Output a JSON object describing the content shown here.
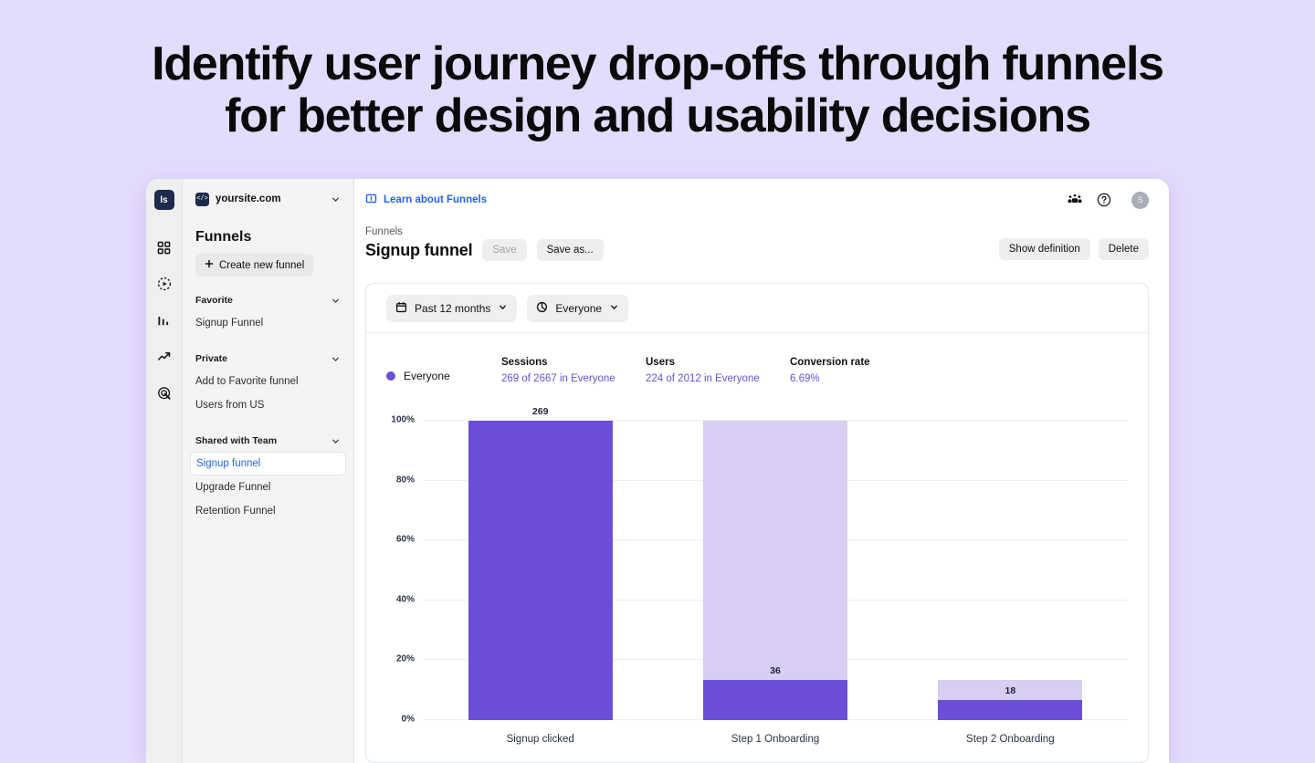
{
  "hero": {
    "headline": "Identify user journey drop-offs through funnels for better design and usability decisions"
  },
  "rail": {
    "logo_text": "ls",
    "items": [
      {
        "icon": "grid-dashboard-icon"
      },
      {
        "icon": "session-replay-icon"
      },
      {
        "icon": "bar-chart-icon"
      },
      {
        "icon": "trend-up-icon"
      },
      {
        "icon": "funnel-target-icon"
      }
    ]
  },
  "sidebar": {
    "site_badge": "</>",
    "site_name": "yoursite.com",
    "heading": "Funnels",
    "create_button": "Create new funnel",
    "groups": [
      {
        "label": "Favorite",
        "items": [
          {
            "label": "Signup Funnel",
            "active": false
          }
        ]
      },
      {
        "label": "Private",
        "items": [
          {
            "label": "Add to Favorite funnel",
            "active": false
          },
          {
            "label": "Users from US",
            "active": false
          }
        ]
      },
      {
        "label": "Shared with Team",
        "items": [
          {
            "label": "Signup funnel",
            "active": true
          },
          {
            "label": "Upgrade Funnel",
            "active": false
          },
          {
            "label": "Retention Funnel",
            "active": false
          }
        ]
      }
    ]
  },
  "topbar": {
    "learn_link": "Learn about Funnels",
    "team_icon": "team-icon",
    "help_icon": "help-circle-icon",
    "avatar_initial": "S"
  },
  "page": {
    "breadcrumb": "Funnels",
    "title": "Signup funnel",
    "save_label": "Save",
    "save_as_label": "Save as...",
    "show_definition_label": "Show definition",
    "delete_label": "Delete"
  },
  "filters": {
    "date_range": "Past 12 months",
    "segment": "Everyone"
  },
  "stats": {
    "legend_label": "Everyone",
    "items": [
      {
        "label": "Sessions",
        "value": "269 of 2667 in Everyone",
        "link": true
      },
      {
        "label": "Users",
        "value": "224 of 2012 in Everyone",
        "link": true
      },
      {
        "label": "Conversion rate",
        "value": "6.69%",
        "link": false
      }
    ]
  },
  "colors": {
    "page_background": "#e4dcfd",
    "bar_fill": "#6c4fd6",
    "bar_track": "#d7cef2",
    "link": "#2463eb"
  },
  "chart_data": {
    "type": "bar",
    "title": "",
    "xlabel": "",
    "ylabel": "",
    "ylim": [
      0,
      100
    ],
    "grid": true,
    "legend_position": "top-left",
    "yticks": [
      "0%",
      "20%",
      "40%",
      "60%",
      "80%",
      "100%"
    ],
    "ytick_values": [
      0,
      20,
      40,
      60,
      80,
      100
    ],
    "categories": [
      "Signup clicked",
      "Step 1 Onboarding",
      "Step 2 Onboarding"
    ],
    "series": [
      {
        "name": "Everyone",
        "values": [
          269,
          36,
          18
        ],
        "percent_of_first": [
          100,
          13.4,
          6.69
        ]
      }
    ],
    "track_percent": [
      100,
      100,
      13.4
    ],
    "data_labels": [
      "269",
      "36",
      "18"
    ]
  }
}
